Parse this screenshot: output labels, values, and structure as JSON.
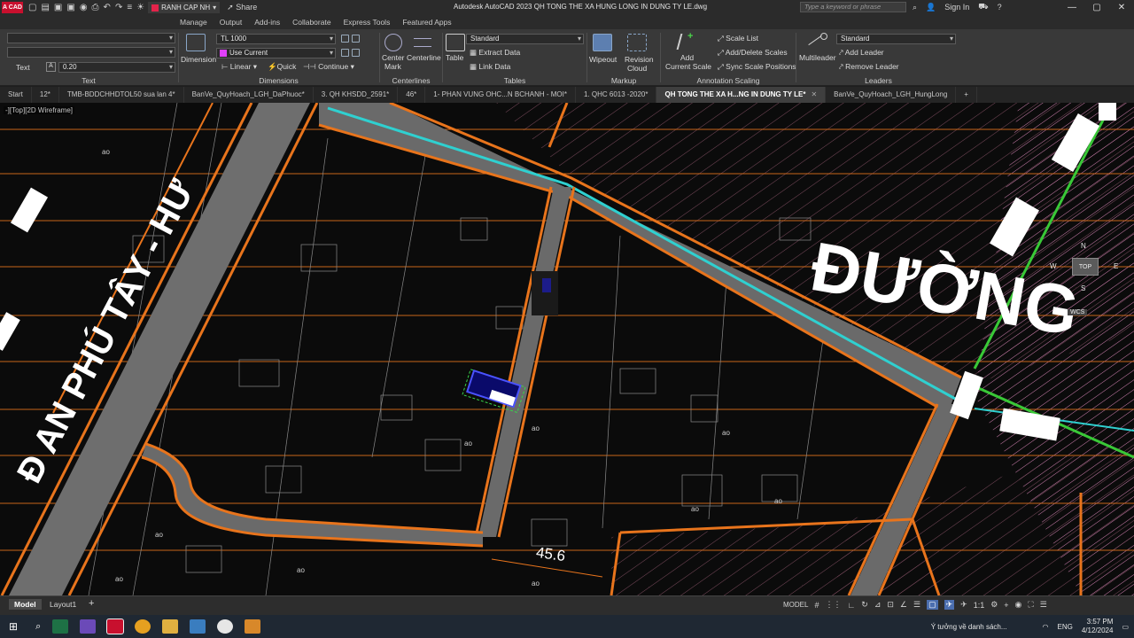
{
  "titlebar": {
    "logo": "A CAD",
    "layer_combo": "RANH CAP NH",
    "share": "Share",
    "window_title": "Autodesk AutoCAD 2023   QH TONG THE XA HUNG LONG IN DUNG TY LE.dwg",
    "search_placeholder": "Type a keyword or phrase",
    "sign_in": "Sign In"
  },
  "ribbon_tabs": [
    "Manage",
    "Output",
    "Add-ins",
    "Collaborate",
    "Express Tools",
    "Featured Apps"
  ],
  "ribbon": {
    "text_group": {
      "title": "Text",
      "text_label": "Text",
      "height_value": "0.20"
    },
    "dimensions_group": {
      "title": "Dimensions",
      "dimension_label": "Dimension",
      "dimstyle": "TL 1000",
      "layer": "Use Current",
      "linear": "Linear",
      "quick": "Quick",
      "continue": "Continue"
    },
    "centerlines_group": {
      "title": "Centerlines",
      "center_mark_line1": "Center",
      "center_mark_line2": "Mark",
      "centerline": "Centerline"
    },
    "tables_group": {
      "title": "Tables",
      "table": "Table",
      "style": "Standard",
      "extract_data": "Extract Data",
      "link_data": "Link Data"
    },
    "markup_group": {
      "title": "Markup",
      "wipeout": "Wipeout",
      "revision_line1": "Revision",
      "revision_line2": "Cloud"
    },
    "annotation_scaling_group": {
      "title": "Annotation Scaling",
      "add_line1": "Add",
      "add_line2": "Current Scale",
      "scale_list": "Scale List",
      "add_delete_scales": "Add/Delete Scales",
      "sync_scale_positions": "Sync Scale Positions"
    },
    "leaders_group": {
      "title": "Leaders",
      "multileader": "Multileader",
      "style": "Standard",
      "add_leader": "Add Leader",
      "remove_leader": "Remove Leader"
    }
  },
  "file_tabs": [
    {
      "label": "Start",
      "active": false
    },
    {
      "label": "12*",
      "active": false
    },
    {
      "label": "TMB-BDDCHHDTOL50 sua lan 4*",
      "active": false
    },
    {
      "label": "BanVe_QuyHoach_LGH_DaPhuoc*",
      "active": false
    },
    {
      "label": "3. QH KHSDD_2591*",
      "active": false
    },
    {
      "label": "46*",
      "active": false
    },
    {
      "label": "1- PHAN VUNG OHC...N BCHANH - MOI*",
      "active": false
    },
    {
      "label": "1. QHC 6013 -2020*",
      "active": false
    },
    {
      "label": "QH TONG THE XA H...NG IN DUNG TY LE*",
      "active": true
    },
    {
      "label": "BanVe_QuyHoach_LGH_HungLong",
      "active": false
    }
  ],
  "canvas": {
    "view_label": "-][Top][2D Wireframe]",
    "road_label_left": "Đ AN PHÚ TÂY - HƯ",
    "road_label_right": "ĐƯỜNG",
    "dimension_text": "45.6",
    "lot_label": "ao",
    "viewcube": {
      "top": "TOP",
      "north": "N",
      "south": "S",
      "west": "W",
      "east": "E",
      "wcs": "WCS"
    }
  },
  "statusbar": {
    "tabs": [
      "Model",
      "Layout1"
    ],
    "add_tab": "+",
    "model_label": "MODEL",
    "scale": "1:1"
  },
  "taskbar": {
    "language": "ENG",
    "time": "3:57 PM",
    "date": "4/12/2024",
    "notification": "Ý tưởng về danh sách..."
  },
  "colors": {
    "road_orange": "#e8741c",
    "cyan_line": "#2fd0d0",
    "green_line": "#39c837",
    "hatch_pink": "#b56f8a",
    "road_gray": "#6e6e6e"
  }
}
